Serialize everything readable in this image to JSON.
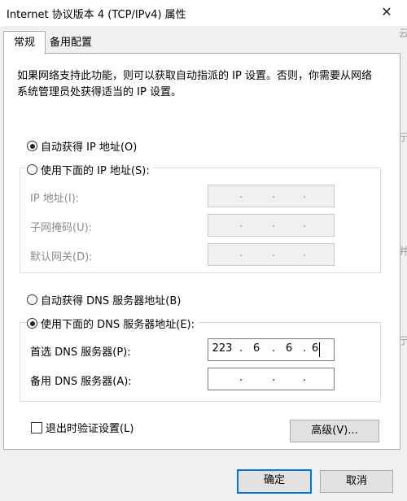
{
  "window": {
    "title": "Internet 协议版本 4 (TCP/IPv4) 属性",
    "close_glyph": "✕"
  },
  "tabs": [
    {
      "label": "常规",
      "active": true
    },
    {
      "label": "备用配置",
      "active": false
    }
  ],
  "description": "如果网络支持此功能，则可以获取自动指派的 IP 设置。否则，你需要从网络系统管理员处获得适当的 IP 设置。",
  "ip": {
    "auto_label": "自动获得 IP 地址(O)",
    "manual_label": "使用下面的 IP 地址(S):",
    "selected": "auto",
    "fields": [
      {
        "label": "IP 地址(I):",
        "value": [
          "",
          "",
          "",
          ""
        ]
      },
      {
        "label": "子网掩码(U):",
        "value": [
          "",
          "",
          "",
          ""
        ]
      },
      {
        "label": "默认网关(D):",
        "value": [
          "",
          "",
          "",
          ""
        ]
      }
    ]
  },
  "dns": {
    "auto_label": "自动获得 DNS 服务器地址(B)",
    "manual_label": "使用下面的 DNS 服务器地址(E):",
    "selected": "manual",
    "fields": [
      {
        "label": "首选 DNS 服务器(P):",
        "value": [
          "223",
          "6",
          "6",
          "6"
        ]
      },
      {
        "label": "备用 DNS 服务器(A):",
        "value": [
          "",
          "",
          "",
          ""
        ]
      }
    ]
  },
  "validate_on_exit": {
    "label": "退出时验证设置(L)",
    "checked": false
  },
  "buttons": {
    "advanced": "高级(V)...",
    "ok": "确定",
    "cancel": "取消"
  },
  "background_fragments": [
    "云",
    "亍",
    "并",
    "亍"
  ],
  "dot_glyph": "."
}
